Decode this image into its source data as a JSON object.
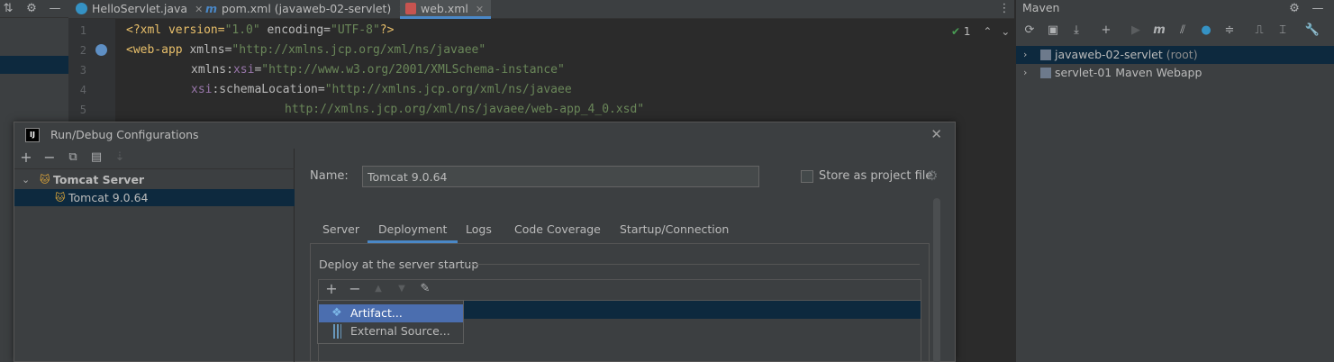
{
  "tabs": [
    {
      "label": "HelloServlet.java",
      "icon": "class-icon"
    },
    {
      "label": "pom.xml (javaweb-02-servlet)",
      "icon": "maven-icon"
    },
    {
      "label": "web.xml",
      "icon": "xml-icon"
    }
  ],
  "editor": {
    "line_numbers": [
      "1",
      "2",
      "3",
      "4",
      "5"
    ],
    "inspection_count": "1",
    "lines": [
      {
        "t1": "<?xml version=",
        "t2": "\"1.0\"",
        "t3": " encoding=",
        "t4": "\"UTF-8\"",
        "t5": "?>"
      },
      {
        "t1": "<web-app",
        "t2": " xmlns=",
        "t3": "\"http://xmlns.jcp.org/xml/ns/javaee\""
      },
      {
        "t1": "xmlns:",
        "t2": "xsi",
        "t3": "=",
        "t4": "\"http://www.w3.org/2001/XMLSchema-instance\""
      },
      {
        "t1": "xsi",
        "t2": ":schemaLocation=",
        "t3": "\"http://xmlns.jcp.org/xml/ns/javaee"
      },
      {
        "t1": "http://xmlns.jcp.org/xml/ns/javaee/web-app_4_0.xsd\""
      }
    ]
  },
  "maven": {
    "title": "Maven",
    "projects": [
      {
        "label": "javaweb-02-servlet",
        "suffix": " (root)"
      },
      {
        "label": "servlet-01 Maven Webapp",
        "suffix": ""
      }
    ]
  },
  "dialog": {
    "title": "Run/Debug Configurations",
    "logo": "IJ",
    "tree": {
      "group": "Tomcat Server",
      "item": "Tomcat 9.0.64"
    },
    "name_label": "Name:",
    "name_value": "Tomcat 9.0.64",
    "store_label": "Store as project file",
    "tabs": [
      "Server",
      "Deployment",
      "Logs",
      "Code Coverage",
      "Startup/Connection"
    ],
    "active_tab": "Deployment",
    "deploy_label": "Deploy at the server startup"
  },
  "popup": {
    "items": [
      "Artifact...",
      "External Source..."
    ]
  },
  "colors": {
    "accent": "#4a88c7",
    "selection": "#0d293e",
    "popup_selection": "#4b6eaf"
  }
}
